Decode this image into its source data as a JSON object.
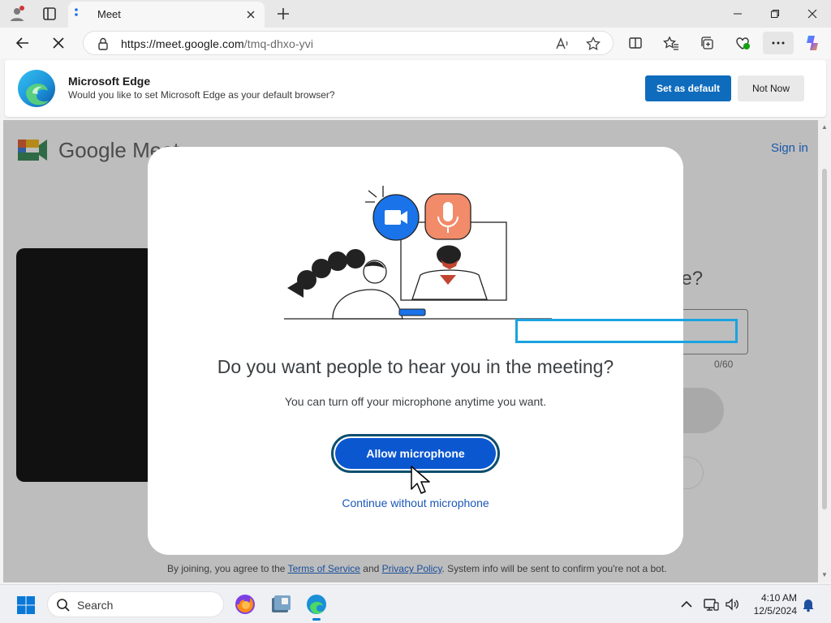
{
  "browser": {
    "tab_title": "Meet",
    "url_host": "https://meet.google.com",
    "url_path": "/tmq-dhxo-yvi"
  },
  "banner": {
    "title": "Microsoft Edge",
    "text": "Would you like to set Microsoft Edge as your default browser?",
    "set_default_label": "Set as default",
    "not_now_label": "Not Now"
  },
  "page": {
    "logo_text": "Google Meet",
    "sign_in": "Sign in",
    "question_fragment": "ne?",
    "char_count": "0/60",
    "footer_prefix": "By joining, you agree to the",
    "terms_link": "Terms of Service",
    "footer_and": "and",
    "privacy_link": "Privacy Policy",
    "footer_suffix": ". System info will be sent to confirm you're not a bot."
  },
  "modal": {
    "title": "Do you want people to hear you in the meeting?",
    "subtitle": "You can turn off your microphone anytime you want.",
    "allow_label": "Allow microphone",
    "continue_label": "Continue without microphone"
  },
  "taskbar": {
    "search_label": "Search",
    "time": "4:10 AM",
    "date": "12/5/2024"
  },
  "colors": {
    "primary_blue": "#0b57d0",
    "edge_blue": "#0f6cbd",
    "highlight": "#1aa3e0"
  }
}
